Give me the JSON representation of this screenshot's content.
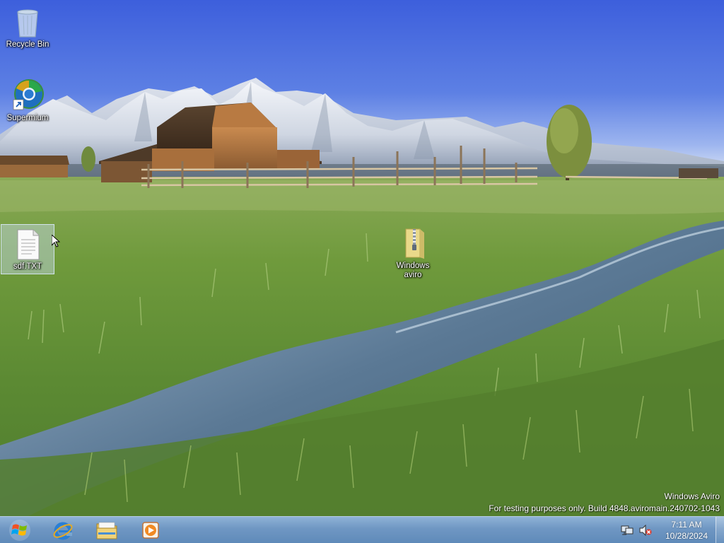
{
  "desktop": {
    "icons": [
      {
        "label": "Recycle Bin",
        "icon": "recycle-bin-icon"
      },
      {
        "label": "Supermium",
        "icon": "supermium-browser-icon"
      },
      {
        "label": "sdf.TXT",
        "icon": "text-file-icon"
      },
      {
        "label": "Windows aviro",
        "icon": "zip-folder-icon"
      }
    ]
  },
  "watermark": {
    "line1": "Windows Aviro",
    "line2": "For testing purposes only. Build 4848.aviromain.240702-1043"
  },
  "taskbar": {
    "start_icon": "windows-logo-icon",
    "pinned": [
      {
        "name": "Internet Explorer",
        "icon": "internet-explorer-icon"
      },
      {
        "name": "File Explorer",
        "icon": "file-explorer-icon"
      },
      {
        "name": "Media Player",
        "icon": "media-player-icon"
      }
    ],
    "tray": {
      "icons": [
        "network-icon",
        "volume-muted-icon"
      ],
      "time": "7:11 AM",
      "date": "10/28/2024"
    }
  },
  "colors": {
    "taskbar": "#6f97c3",
    "sky_top": "#3d5fdc",
    "grass": "#6f9a3c",
    "water": "#4d6a86"
  }
}
